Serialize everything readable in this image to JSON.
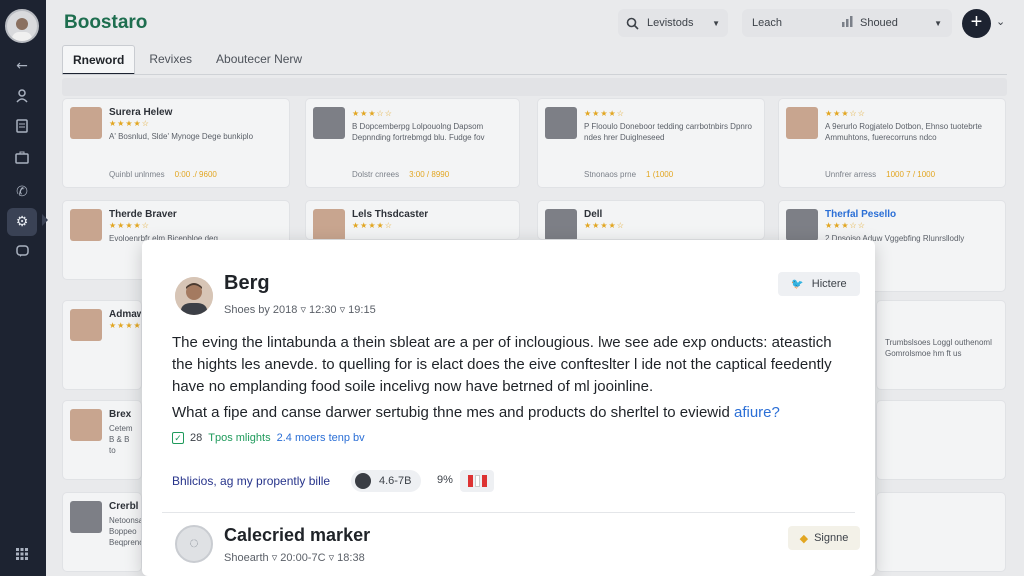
{
  "app": {
    "brand": "Boostaro"
  },
  "header": {
    "search_label": "Levistods",
    "filter_label": "Leach",
    "filter_value": "Shoued"
  },
  "tabs": [
    {
      "label": "Rneword",
      "active": true
    },
    {
      "label": "Revixes",
      "active": false
    },
    {
      "label": "Aboutecer Nerw",
      "active": false
    }
  ],
  "sidebar": {
    "icons": [
      "back-arrow-icon",
      "user-icon",
      "document-icon",
      "briefcase-icon",
      "phone-icon",
      "settings-icon",
      "chat-icon",
      "grid-icon"
    ]
  },
  "cards": [
    {
      "name": "Surera Helew",
      "stars": "★★★★☆",
      "text": "A' Bosnlud, Slde' Mynoge Dege bunkiplo",
      "meta": [
        "Quinbl unlnmes",
        "0:00 ./ 9600"
      ]
    },
    {
      "name": "",
      "stars": "★★★☆☆",
      "text": "B Dopcemberpg Lolpouolng Dapsom Depnnding fortrebmgd blu. Fudge fov",
      "meta": [
        "Dolstr cnrees",
        "3:00 / 8990"
      ]
    },
    {
      "name": "",
      "stars": "★★★★☆",
      "text": "P Flooulo Doneboor tedding carrbotnbirs Dpnro ndes hrer Duiglneseed",
      "meta": [
        "Stnonaos prne",
        "1 (1000"
      ]
    },
    {
      "name": "",
      "stars": "★★★☆☆",
      "text": "A 9erurlo Rogjatelo Dotbon, Ehnso tuotebrte Ammuhtons, fuerecorruns ndco",
      "meta": [
        "Unnfrer arress",
        "1000 7 / 1000"
      ]
    },
    {
      "name": "Therde Braver",
      "stars": "★★★★☆",
      "text": "Evoloenrbfr elm Bicenbloe deg",
      "meta": []
    },
    {
      "name": "Lels Thsdcaster",
      "stars": "★★★★☆",
      "text": "",
      "meta": []
    },
    {
      "name": "Dell",
      "stars": "★★★★☆",
      "text": "",
      "meta": []
    },
    {
      "name": "Therfal Pesello",
      "stars": "★★★☆☆",
      "text": "2 Dnsoiso Aduw Vggebfing Rlunrsllodly ghamooda",
      "meta": []
    },
    {
      "name": "Admaw",
      "stars": "★★★★☆",
      "text": "",
      "meta": []
    },
    {
      "name": "",
      "stars": "",
      "text": "Trumbslsoes Loggl outhenoml Gomrolsmoe hm ft us",
      "meta": []
    },
    {
      "name": "Brex",
      "stars": "",
      "text": "Cetem B & B to",
      "meta": []
    },
    {
      "name": "Crerbl",
      "stars": "",
      "text": "Netoonsa Boppeo Beqpreno",
      "meta": []
    }
  ],
  "modal": {
    "title": "Berg",
    "subtitle": "Shoes by 2018 ▿ 12:30 ▿ 19:15",
    "hide_label": "Hictere",
    "body": "The eving the lintabunda a thein sbleat are a per of inclougious. lwe see ade exp onducts: ateastich the hights les anevde. to quelling for is elact does the eive confteslter l ide not the captical feedently have no emplanding food soile incelivg now have betrned of ml jooinline.",
    "question_prefix": "What a fipe and canse darwer sertubig thne mes and products do sherltel to eviewid",
    "question_accent": "afiure?",
    "stats": {
      "count": "28",
      "highlights": "Tpos mlights",
      "meta": "2.4 moers tenp bv"
    },
    "link_text": "Bhlicios, ag my propently bille",
    "pill_value": "4.6-7B",
    "pct": "9%"
  },
  "second_item": {
    "title": "Calecried marker",
    "subtitle": "Shoearth ▿ 20:00-7C ▿ 18:38",
    "button_label": "Signne"
  }
}
